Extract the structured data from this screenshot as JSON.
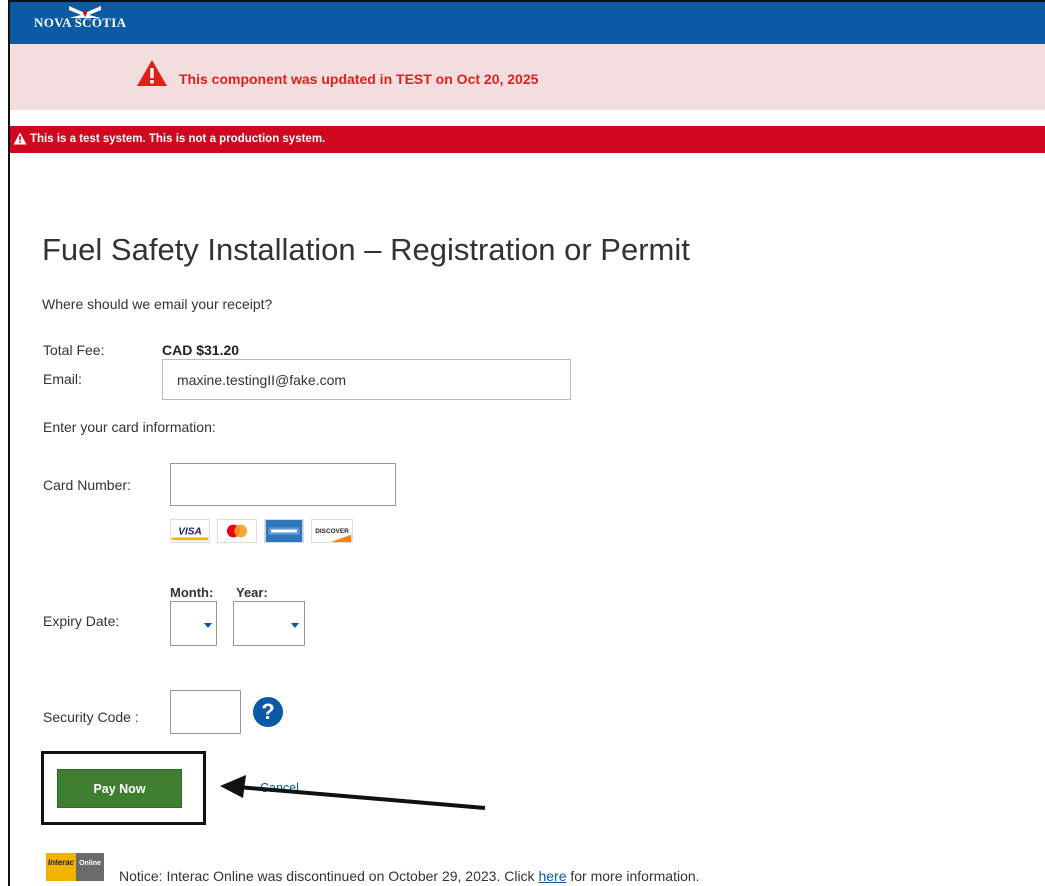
{
  "header": {
    "logo_text": "NOVA SCOTIA",
    "color": "#0a5aa6"
  },
  "update_banner": {
    "text": "This component was updated in TEST on Oct 20, 2025",
    "icon": "warning-triangle-icon",
    "color": "#e0201a"
  },
  "test_banner": {
    "text": "This is a test system. This is not a production system.",
    "icon": "warning-triangle-icon",
    "color": "#d0071e"
  },
  "page": {
    "title": "Fuel Safety Installation – Registration or Permit",
    "receipt_question": "Where should we email your receipt?"
  },
  "form": {
    "total_fee_label": "Total Fee:",
    "total_fee_value": "CAD $31.20",
    "email_label": "Email:",
    "email_value": "maxine.testingII@fake.com",
    "card_info_label": "Enter your card information:",
    "card_number_label": "Card Number:",
    "card_number_value": "",
    "card_logos": [
      "VISA",
      "mastercard-icon",
      "amex-icon",
      "DISCOVER"
    ],
    "month_label": "Month:",
    "year_label": "Year:",
    "expiry_label": "Expiry Date:",
    "month_value": "",
    "year_value": "",
    "security_label": "Security Code :",
    "security_value": "",
    "help_symbol": "?"
  },
  "actions": {
    "pay_label": "Pay Now",
    "cancel_label": "Cancel",
    "pay_color": "#3f7f32"
  },
  "notice": {
    "interac_line1": "Interac",
    "interac_line2": "Online",
    "prefix": "Notice: Interac Online was discontinued on October 29, 2023. Click ",
    "link": "here",
    "suffix": " for more information."
  }
}
